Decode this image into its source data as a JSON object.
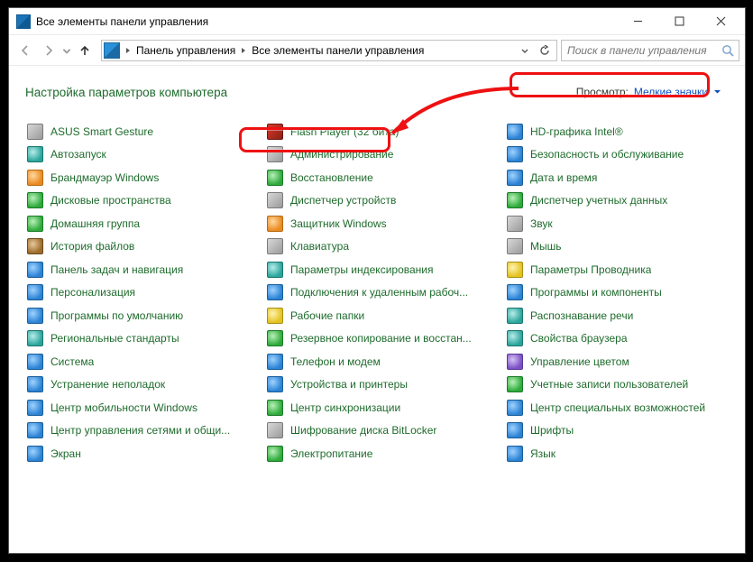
{
  "window": {
    "title": "Все элементы панели управления"
  },
  "nav": {
    "crumb1": "Панель управления",
    "crumb2": "Все элементы панели управления",
    "search_placeholder": "Поиск в панели управления"
  },
  "header": {
    "page_title": "Настройка параметров компьютера",
    "view_label": "Просмотр:",
    "view_value": "Мелкие значки"
  },
  "cols": [
    [
      {
        "label": "ASUS Smart Gesture",
        "ic": "gray"
      },
      {
        "label": "Автозапуск",
        "ic": "teal"
      },
      {
        "label": "Брандмауэр Windows",
        "ic": "orange"
      },
      {
        "label": "Дисковые пространства",
        "ic": "green"
      },
      {
        "label": "Домашняя группа",
        "ic": "green"
      },
      {
        "label": "История файлов",
        "ic": "brown"
      },
      {
        "label": "Панель задач и навигация",
        "ic": "blue"
      },
      {
        "label": "Персонализация",
        "ic": "blue"
      },
      {
        "label": "Программы по умолчанию",
        "ic": "blue"
      },
      {
        "label": "Региональные стандарты",
        "ic": "teal"
      },
      {
        "label": "Система",
        "ic": "blue"
      },
      {
        "label": "Устранение неполадок",
        "ic": "blue"
      },
      {
        "label": "Центр мобильности Windows",
        "ic": "blue"
      },
      {
        "label": "Центр управления сетями и общи...",
        "ic": "blue"
      },
      {
        "label": "Экран",
        "ic": "blue"
      }
    ],
    [
      {
        "label": "Flash Player (32 бита)",
        "ic": "red"
      },
      {
        "label": "Администрирование",
        "ic": "gray"
      },
      {
        "label": "Восстановление",
        "ic": "green"
      },
      {
        "label": "Диспетчер устройств",
        "ic": "gray"
      },
      {
        "label": "Защитник Windows",
        "ic": "orange"
      },
      {
        "label": "Клавиатура",
        "ic": "gray"
      },
      {
        "label": "Параметры индексирования",
        "ic": "teal"
      },
      {
        "label": "Подключения к удаленным рабоч...",
        "ic": "blue"
      },
      {
        "label": "Рабочие папки",
        "ic": "yellow"
      },
      {
        "label": "Резервное копирование и восстан...",
        "ic": "green"
      },
      {
        "label": "Телефон и модем",
        "ic": "blue"
      },
      {
        "label": "Устройства и принтеры",
        "ic": "blue"
      },
      {
        "label": "Центр синхронизации",
        "ic": "green"
      },
      {
        "label": "Шифрование диска BitLocker",
        "ic": "gray"
      },
      {
        "label": "Электропитание",
        "ic": "green"
      }
    ],
    [
      {
        "label": "HD-графика Intel®",
        "ic": "blue"
      },
      {
        "label": "Безопасность и обслуживание",
        "ic": "blue"
      },
      {
        "label": "Дата и время",
        "ic": "blue"
      },
      {
        "label": "Диспетчер учетных данных",
        "ic": "green"
      },
      {
        "label": "Звук",
        "ic": "gray"
      },
      {
        "label": "Мышь",
        "ic": "gray"
      },
      {
        "label": "Параметры Проводника",
        "ic": "yellow"
      },
      {
        "label": "Программы и компоненты",
        "ic": "blue"
      },
      {
        "label": "Распознавание речи",
        "ic": "teal"
      },
      {
        "label": "Свойства браузера",
        "ic": "teal"
      },
      {
        "label": "Управление цветом",
        "ic": "purple"
      },
      {
        "label": "Учетные записи пользователей",
        "ic": "green"
      },
      {
        "label": "Центр специальных возможностей",
        "ic": "blue"
      },
      {
        "label": "Шрифты",
        "ic": "blue"
      },
      {
        "label": "Язык",
        "ic": "blue"
      }
    ]
  ]
}
